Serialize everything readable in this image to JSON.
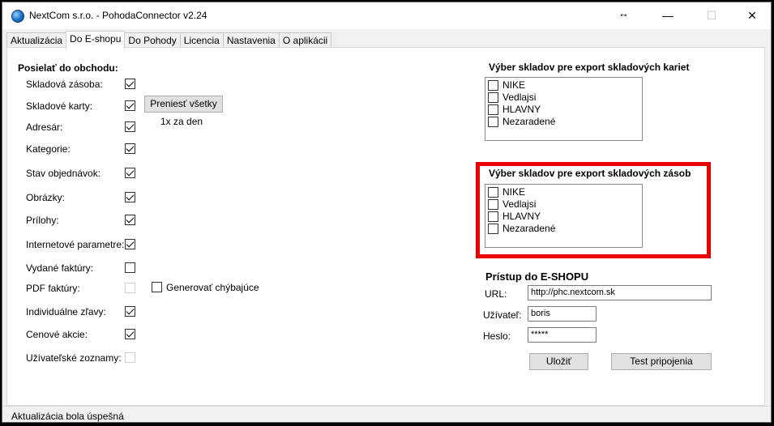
{
  "window": {
    "title": "NextCom s.r.o. - PohodaConnector v2.24",
    "resize_glyph": "↔",
    "minimize_glyph": "—",
    "maximize_glyph": "☐",
    "close_glyph": "✕"
  },
  "tabs": [
    "Aktualizácia",
    "Do E-shopu",
    "Do Pohody",
    "Licencia",
    "Nastavenia",
    "O aplikácii"
  ],
  "active_tab": "Do E-shopu",
  "send_section": {
    "heading": "Posielať do obchodu:",
    "items": [
      {
        "label": "Skladová zásoba:",
        "checked": true,
        "enabled": true
      },
      {
        "label": "Skladové karty:",
        "checked": true,
        "enabled": true
      },
      {
        "label": "Adresár:",
        "checked": true,
        "enabled": true
      },
      {
        "label": "Kategorie:",
        "checked": true,
        "enabled": true
      },
      {
        "label": "Stav objednávok:",
        "checked": true,
        "enabled": true
      },
      {
        "label": "Obrázky:",
        "checked": true,
        "enabled": true
      },
      {
        "label": "Prílohy:",
        "checked": true,
        "enabled": true
      },
      {
        "label": "Internetové parametre:",
        "checked": true,
        "enabled": true
      },
      {
        "label": "Vydané faktúry:",
        "checked": false,
        "enabled": true
      },
      {
        "label": "PDF faktúry:",
        "checked": false,
        "enabled": false
      },
      {
        "label": "Individuálne zľavy:",
        "checked": true,
        "enabled": true
      },
      {
        "label": "Cenové akcie:",
        "checked": true,
        "enabled": true
      },
      {
        "label": "Užívateľské zoznamy:",
        "checked": false,
        "enabled": false
      }
    ],
    "transfer_all_button": "Preniesť všetky",
    "frequency_text": "1x za den",
    "generate_missing": {
      "label": "Generovať chýbajúce",
      "checked": false
    }
  },
  "card_export": {
    "heading": "Výber skladov pre export skladových kariet",
    "items": [
      {
        "label": "NIKE",
        "checked": false
      },
      {
        "label": "Vedlajsi",
        "checked": false
      },
      {
        "label": "HLAVNY",
        "checked": false
      },
      {
        "label": "Nezaradené",
        "checked": false
      }
    ]
  },
  "stock_export": {
    "heading": "Výber skladov pre export skladových zásob",
    "highlight_color": "#e60000",
    "items": [
      {
        "label": "NIKE",
        "checked": false
      },
      {
        "label": "Vedlajsi",
        "checked": false
      },
      {
        "label": "HLAVNY",
        "checked": false
      },
      {
        "label": "Nezaradené",
        "checked": false
      }
    ]
  },
  "eshop_access": {
    "heading": "Prístup do E-SHOPU",
    "url_label": "URL:",
    "url_value": "http://phc.nextcom.sk",
    "user_label": "Užívateľ:",
    "user_value": "boris",
    "password_label": "Heslo:",
    "password_value": "*****",
    "save_button": "Uložiť",
    "test_button": "Test pripojenia"
  },
  "status": {
    "text": "Aktualizácia bola úspešná"
  }
}
